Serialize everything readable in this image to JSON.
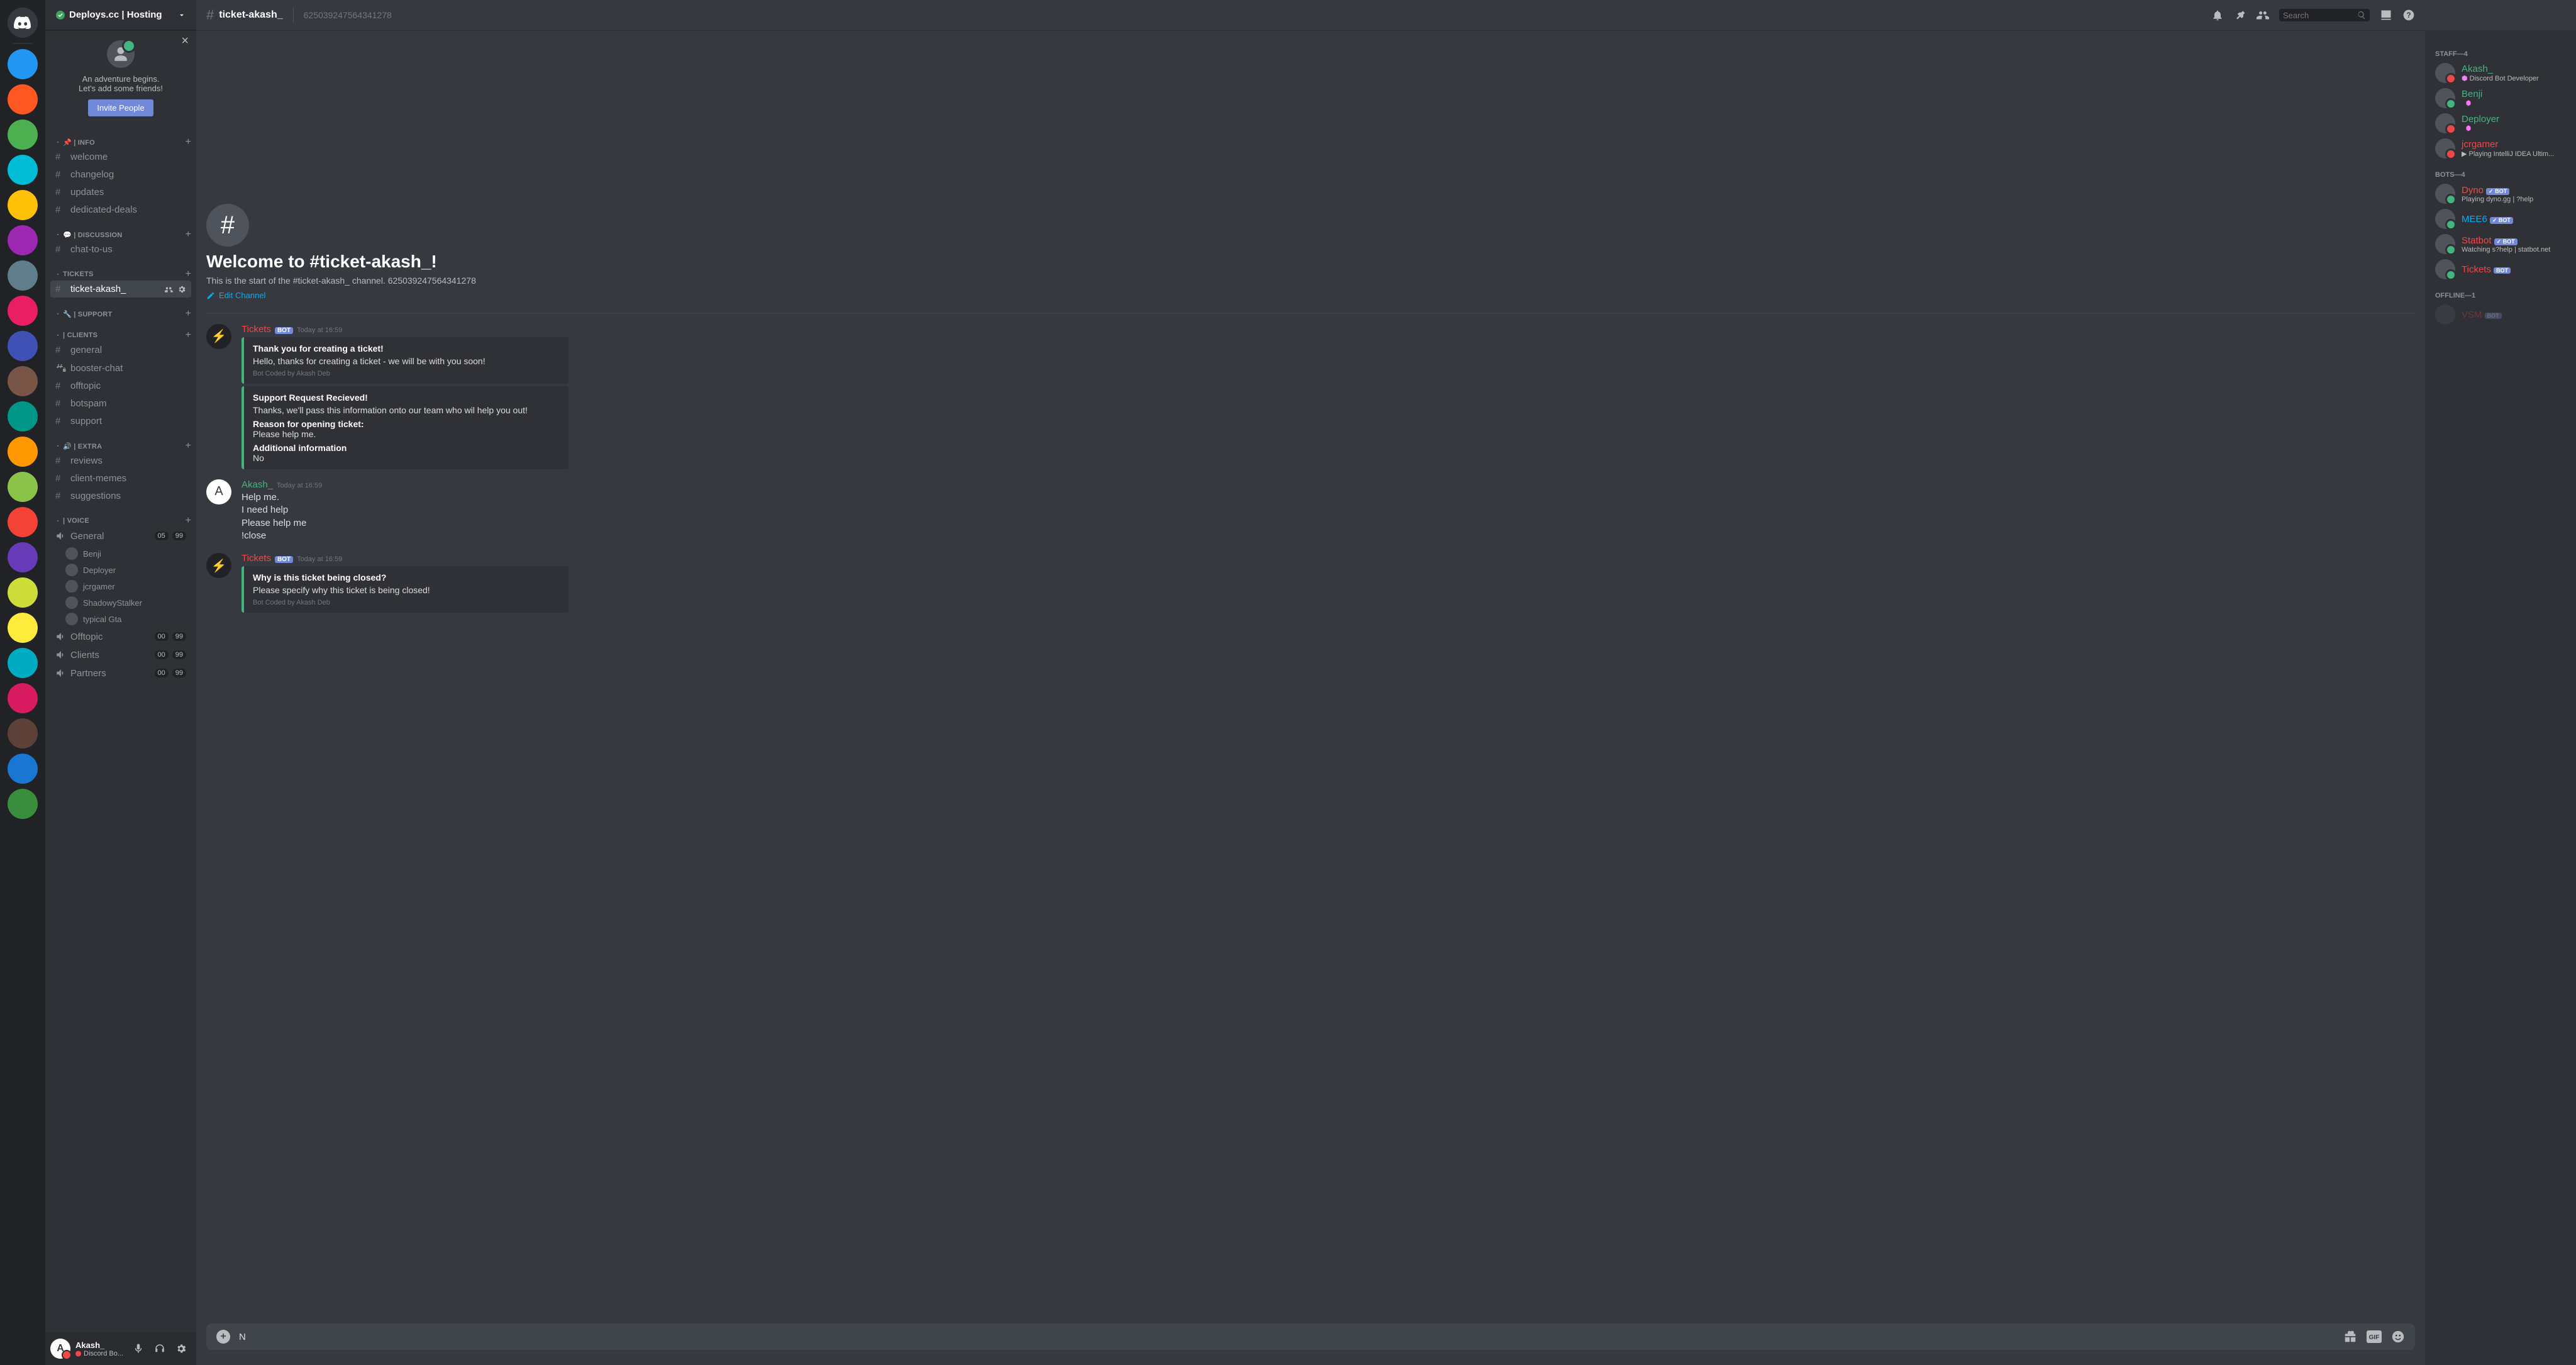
{
  "server": {
    "name": "Deploys.cc | Hosting"
  },
  "invite": {
    "line1": "An adventure begins.",
    "line2": "Let's add some friends!",
    "button": "Invite People"
  },
  "categories": [
    {
      "label": "📌 | INFO",
      "channels": [
        {
          "name": "welcome",
          "type": "text"
        },
        {
          "name": "changelog",
          "type": "text"
        },
        {
          "name": "updates",
          "type": "text"
        },
        {
          "name": "dedicated-deals",
          "type": "text"
        }
      ]
    },
    {
      "label": "💬 | DISCUSSION",
      "channels": [
        {
          "name": "chat-to-us",
          "type": "text"
        }
      ]
    },
    {
      "label": "TICKETS",
      "channels": [
        {
          "name": "ticket-akash_",
          "type": "text",
          "selected": true
        }
      ]
    },
    {
      "label": "🔧 | SUPPORT",
      "channels": []
    },
    {
      "label": "| CLIENTS",
      "channels": [
        {
          "name": "general",
          "type": "text"
        },
        {
          "name": "booster-chat",
          "type": "text",
          "locked": true
        },
        {
          "name": "offtopic",
          "type": "text"
        },
        {
          "name": "botspam",
          "type": "text"
        },
        {
          "name": "support",
          "type": "text"
        }
      ]
    },
    {
      "label": "🔊 | EXTRA",
      "channels": [
        {
          "name": "reviews",
          "type": "text"
        },
        {
          "name": "client-memes",
          "type": "text"
        },
        {
          "name": "suggestions",
          "type": "text"
        }
      ]
    },
    {
      "label": "| VOICE",
      "channels": [
        {
          "name": "General",
          "type": "voice",
          "cur": "05",
          "max": "99",
          "users": [
            "Benji",
            "Deployer",
            "jcrgamer",
            "ShadowyStalker",
            "typical Gta"
          ]
        },
        {
          "name": "Offtopic",
          "type": "voice",
          "cur": "00",
          "max": "99"
        },
        {
          "name": "Clients",
          "type": "voice",
          "cur": "00",
          "max": "99"
        },
        {
          "name": "Partners",
          "type": "voice",
          "cur": "00",
          "max": "99"
        }
      ]
    }
  ],
  "me": {
    "name": "Akash_",
    "status": "Discord Bo...",
    "badge_game": "🔴"
  },
  "topbar": {
    "channel": "ticket-akash_",
    "topic": "625039247564341278",
    "search_placeholder": "Search"
  },
  "welcome": {
    "title": "Welcome to #ticket-akash_!",
    "desc": "This is the start of the #ticket-akash_ channel. 625039247564341278",
    "edit": "Edit Channel"
  },
  "messages": [
    {
      "author": "Tickets",
      "color": "#f04747",
      "bot": true,
      "ts": "Today at 16:59",
      "avatar": "⚡",
      "embeds": [
        {
          "title": "Thank you for creating a ticket!",
          "desc": "Hello, thanks for creating a ticket - we will be with you soon!",
          "footer": "Bot Coded by Akash Deb"
        },
        {
          "title": "Support Request Recieved!",
          "desc": "Thanks, we'll pass this information onto our team who wil help you out!",
          "fields": [
            {
              "name": "Reason for opening ticket:",
              "value": "Please help me."
            },
            {
              "name": "Additional information",
              "value": "No"
            }
          ]
        }
      ]
    },
    {
      "author": "Akash_",
      "color": "#43b581",
      "bot": false,
      "ts": "Today at 16:59",
      "avatar": "A",
      "lines": [
        "Help me.",
        "I need help",
        "Please help me",
        "!close"
      ]
    },
    {
      "author": "Tickets",
      "color": "#f04747",
      "bot": true,
      "ts": "Today at 16:59",
      "avatar": "⚡",
      "embeds": [
        {
          "title": "Why is this ticket being closed?",
          "desc": "Please specify why this ticket is being closed!",
          "footer": "Bot Coded by Akash Deb"
        }
      ]
    }
  ],
  "composer": {
    "value": "N"
  },
  "members": {
    "groups": [
      {
        "label": "STAFF—4",
        "items": [
          {
            "name": "Akash_",
            "color": "#43b581",
            "status": "dnd",
            "sub": "Discord Bot Developer",
            "badges": [
              "dev",
              "boost"
            ]
          },
          {
            "name": "Benji",
            "color": "#43b581",
            "status": "online",
            "boost": true
          },
          {
            "name": "Deployer",
            "color": "#43b581",
            "status": "dnd",
            "boost": true
          },
          {
            "name": "jcrgamer",
            "color": "#f04747",
            "status": "dnd",
            "sub": "Playing IntelliJ IDEA Ultim...",
            "rich": true
          }
        ]
      },
      {
        "label": "BOTS—4",
        "items": [
          {
            "name": "Dyno",
            "color": "#f04747",
            "status": "online",
            "bot": true,
            "verified": true,
            "sub": "Playing dyno.gg | ?help"
          },
          {
            "name": "MEE6",
            "color": "#00b0f4",
            "status": "online",
            "bot": true,
            "verified": true
          },
          {
            "name": "Statbot",
            "color": "#f04747",
            "status": "online",
            "bot": true,
            "verified": true,
            "sub": "Watching s?help | statbot.net"
          },
          {
            "name": "Tickets",
            "color": "#f04747",
            "status": "online",
            "bot": true
          }
        ]
      },
      {
        "label": "OFFLINE—1",
        "items": [
          {
            "name": "VSM",
            "color": "#f04747",
            "status": "offline",
            "bot": true,
            "offline": true
          }
        ]
      }
    ]
  },
  "bot_label": "BOT",
  "glyph": {
    "check": "✓"
  }
}
